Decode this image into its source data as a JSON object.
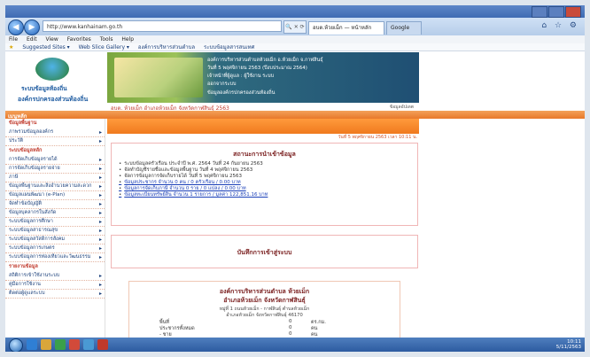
{
  "browser": {
    "url": "http://www.kanhainam.go.th",
    "url_tools": "🔍 ✕ ⟳",
    "tabs": [
      {
        "label": "อบต.ห้วยเม็ก — หน้าหลัก",
        "state": "active"
      },
      {
        "label": "Google",
        "state": "inactive"
      }
    ],
    "menu": [
      "File",
      "Edit",
      "View",
      "Favorites",
      "Tools",
      "Help"
    ],
    "favorites": [
      "Suggested Sites ▾",
      "Web Slice Gallery ▾",
      "องค์การบริหารส่วนตำบล",
      "ระบบข้อมูลสารสนเทศ"
    ],
    "nav_back_icon": "back-arrow-icon",
    "nav_forward_icon": "forward-arrow-icon",
    "right_icons": "⌂ ☆ ⚙"
  },
  "site": {
    "logo_title_1": "ระบบข้อมูลท้องถิ่น",
    "logo_title_2": "องค์กรปกครองส่วนท้องถิ่น",
    "banner_lines": [
      "องค์การบริหารส่วนตำบลห้วยเม็ก อ.ห้วยเม็ก จ.กาฬสินธุ์",
      "วันที่ 5 พฤศจิกายน 2563 (ปีงบประมาณ 2564)",
      "เจ้าหน้าที่ผู้ดูแล : ผู้ใช้งาน ระบบ",
      "ออกจากระบบ",
      "ข้อมูลองค์กรปกครองส่วนท้องถิ่น"
    ],
    "banner_strip_left": "อบต. ห้วยเม็ก อำเภอห้วยเม็ก จังหวัดกาฬสินธุ์ 2563",
    "banner_strip_right": "ข้อมูลอัปเดต",
    "orange_bar_left": "เมนูหลัก",
    "orange_sub_right": "วันที่ 5 พฤศจิกายน 2563 เวลา 10:11 น.",
    "announcement_title": "สถานะการนำเข้าข้อมูล",
    "news": [
      {
        "text": "ระบบข้อมูลครัวเรือน ประจำปี พ.ศ. 2564 วันที่ 24 กันยายน 2563",
        "link": false
      },
      {
        "text": "จัดทำบัญชีรายชื่อและข้อมูลพื้นฐาน วันที่ 4 พฤศจิกายน 2563",
        "link": false
      },
      {
        "text": "จัดการข้อมูลการจัดเก็บรายได้ วันที่ 5 พฤศจิกายน 2563",
        "link": false
      },
      {
        "text": "ข้อมูลประชากร จำนวน 0 คน / 0 ครัวเรือน / 0.00 บาท",
        "link": true
      },
      {
        "text": "ข้อมูลการจัดเก็บภาษี จำนวน 0 ราย / 0 แปลง / 0.00 บาท",
        "link": true
      },
      {
        "text": "ข้อมูลทะเบียนทรัพย์สิน จำนวน 1 รายการ / มูลค่า 122,851.16 บาท",
        "link": true
      }
    ],
    "record_title": "บันทึกการเข้าสู่ระบบ",
    "stats_title_1": "องค์การบริหารส่วนตำบล ห้วยเม็ก",
    "stats_title_2": "อำเภอห้วยเม็ก จังหวัดกาฬสินธุ์",
    "stats_addr_1": "หมู่ที่ 1 ถนนห้วยเม็ก - กาฬสินธุ์ ตำบลห้วยเม็ก",
    "stats_addr_2": "อำเภอห้วยเม็ก จังหวัดกาฬสินธุ์ 46170",
    "stats": [
      {
        "label": "พื้นที่",
        "value": "0",
        "unit": "ตร.กม."
      },
      {
        "label": "ประชากรทั้งหมด",
        "value": "0",
        "unit": "คน"
      },
      {
        "label": "- ชาย",
        "value": "0",
        "unit": "คน"
      },
      {
        "label": "- หญิง",
        "value": "0",
        "unit": "คน"
      }
    ]
  },
  "sidebar": [
    {
      "type": "section",
      "label": "ข้อมูลพื้นฐาน"
    },
    {
      "type": "item",
      "label": "ภาพรวมข้อมูลองค์กร"
    },
    {
      "type": "item",
      "label": "ประวัติ"
    },
    {
      "type": "section",
      "label": "ระบบข้อมูลหลัก"
    },
    {
      "type": "item",
      "label": "การจัดเก็บข้อมูลรายได้"
    },
    {
      "type": "item",
      "label": "การจัดเก็บข้อมูลรายจ่าย"
    },
    {
      "type": "item",
      "label": "ภาษี"
    },
    {
      "type": "item",
      "label": "ข้อมูลพื้นฐานและสิ่งอำนวยความสะดวก"
    },
    {
      "type": "item",
      "label": "ข้อมูลแผนพัฒนา (e-Plan)"
    },
    {
      "type": "item",
      "label": "จัดทำข้อบัญญัติ"
    },
    {
      "type": "item",
      "label": "ข้อมูลบุคลากรในสังกัด"
    },
    {
      "type": "item",
      "label": "ระบบข้อมูลการศึกษา"
    },
    {
      "type": "item",
      "label": "ระบบข้อมูลสาธารณสุข"
    },
    {
      "type": "item",
      "label": "ระบบข้อมูลสวัสดิการสังคม"
    },
    {
      "type": "item",
      "label": "ระบบข้อมูลการเกษตร"
    },
    {
      "type": "item",
      "label": "ระบบข้อมูลการท่องเที่ยวและวัฒนธรรม"
    },
    {
      "type": "section",
      "label": "รายงานข้อมูล"
    },
    {
      "type": "item",
      "label": "สถิติการเข้าใช้งานระบบ"
    },
    {
      "type": "item",
      "label": "คู่มือการใช้งาน"
    },
    {
      "type": "item",
      "label": "ติดต่อผู้ดูแลระบบ"
    }
  ],
  "taskbar": {
    "tray_time": "10:11",
    "tray_date": "5/11/2563",
    "start_icon": "windows-start-icon"
  },
  "colors": {
    "accent_orange": "#f07a1e",
    "link_blue": "#1a3fb8",
    "title_red": "#7a1f1f",
    "banner_green": "#7aa63e"
  }
}
